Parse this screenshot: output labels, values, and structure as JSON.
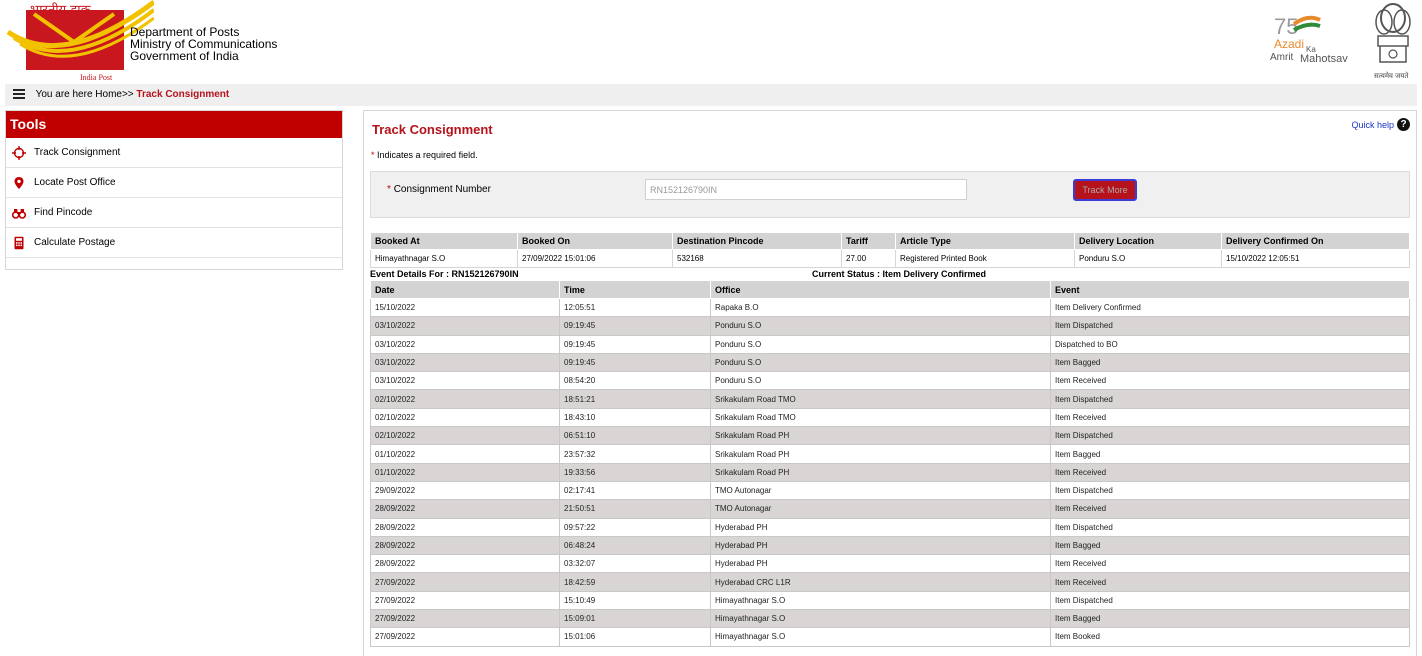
{
  "header": {
    "logo_hindi": "भारतीय डाक",
    "logo_english": "India Post",
    "dept_lines": [
      "Department of Posts",
      "Ministry of Communications",
      "Government of India"
    ],
    "azadi_top": "75",
    "azadi_line1": "Azadi",
    "azadi_ka": "Ka",
    "azadi_line2": "Amrit",
    "azadi_line3": "Mahotsav",
    "emblem_motto": "सत्यमेव जयते"
  },
  "breadcrumb": {
    "prefix": "You are here Home>> ",
    "current": "Track Consignment"
  },
  "tools": {
    "heading": "Tools",
    "items": [
      {
        "label": "Track Consignment",
        "icon": "crosshair-icon"
      },
      {
        "label": "Locate Post Office",
        "icon": "location-pin-icon"
      },
      {
        "label": "Find Pincode",
        "icon": "binoculars-icon"
      },
      {
        "label": "Calculate Postage",
        "icon": "calculator-icon"
      }
    ]
  },
  "main": {
    "title": "Track Consignment",
    "quick_help": "Quick help",
    "required_star": "*",
    "required_note": " Indicates a required field.",
    "form": {
      "label": "Consignment Number",
      "value": "RN152126790IN",
      "button": "Track More"
    },
    "booking": {
      "headers": [
        "Booked At",
        "Booked On",
        "Destination Pincode",
        "Tariff",
        "Article Type",
        "Delivery Location",
        "Delivery Confirmed On"
      ],
      "row": [
        "Himayathnagar S.O",
        "27/09/2022 15:01:06",
        "532168",
        "27.00",
        "Registered Printed Book",
        "Ponduru S.O",
        "15/10/2022 12:05:51"
      ]
    },
    "event_details": "Event Details For : RN152126790IN",
    "current_status": "Current Status : Item Delivery Confirmed",
    "events": {
      "headers": [
        "Date",
        "Time",
        "Office",
        "Event"
      ],
      "rows": [
        [
          "15/10/2022",
          "12:05:51",
          "Rapaka B.O",
          "Item Delivery Confirmed"
        ],
        [
          "03/10/2022",
          "09:19:45",
          "Ponduru S.O",
          "Item Dispatched"
        ],
        [
          "03/10/2022",
          "09:19:45",
          "Ponduru S.O",
          "Dispatched to BO"
        ],
        [
          "03/10/2022",
          "09:19:45",
          "Ponduru S.O",
          "Item Bagged"
        ],
        [
          "03/10/2022",
          "08:54:20",
          "Ponduru S.O",
          "Item Received"
        ],
        [
          "02/10/2022",
          "18:51:21",
          "Srikakulam Road TMO",
          "Item Dispatched"
        ],
        [
          "02/10/2022",
          "18:43:10",
          "Srikakulam Road TMO",
          "Item Received"
        ],
        [
          "02/10/2022",
          "06:51:10",
          "Srikakulam Road PH",
          "Item Dispatched"
        ],
        [
          "01/10/2022",
          "23:57:32",
          "Srikakulam Road PH",
          "Item Bagged"
        ],
        [
          "01/10/2022",
          "19:33:56",
          "Srikakulam Road PH",
          "Item Received"
        ],
        [
          "29/09/2022",
          "02:17:41",
          "TMO Autonagar",
          "Item Dispatched"
        ],
        [
          "28/09/2022",
          "21:50:51",
          "TMO Autonagar",
          "Item Received"
        ],
        [
          "28/09/2022",
          "09:57:22",
          "Hyderabad PH",
          "Item Dispatched"
        ],
        [
          "28/09/2022",
          "06:48:24",
          "Hyderabad PH",
          "Item Bagged"
        ],
        [
          "28/09/2022",
          "03:32:07",
          "Hyderabad PH",
          "Item Received"
        ],
        [
          "27/09/2022",
          "18:42:59",
          "Hyderabad CRC L1R",
          "Item Received"
        ],
        [
          "27/09/2022",
          "15:10:49",
          "Himayathnagar S.O",
          "Item Dispatched"
        ],
        [
          "27/09/2022",
          "15:09:01",
          "Himayathnagar S.O",
          "Item Bagged"
        ],
        [
          "27/09/2022",
          "15:01:06",
          "Himayathnagar S.O",
          "Item Booked"
        ]
      ]
    }
  },
  "colors": {
    "brand_red": "#c00000",
    "accent_red": "#b5121b",
    "logo_yellow": "#f2c200",
    "link_blue": "#1a36c9"
  }
}
